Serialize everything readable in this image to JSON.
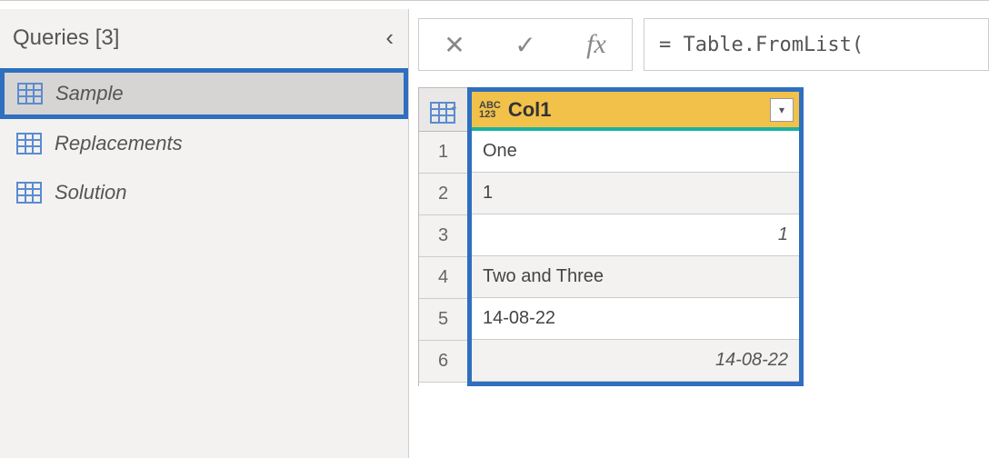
{
  "queries": {
    "header": "Queries [3]",
    "items": [
      {
        "name": "Sample",
        "selected": true
      },
      {
        "name": "Replacements",
        "selected": false
      },
      {
        "name": "Solution",
        "selected": false
      }
    ]
  },
  "formula_bar": {
    "expression": "= Table.FromList("
  },
  "table": {
    "column": {
      "type_hint_top": "ABC",
      "type_hint_bottom": "123",
      "name": "Col1"
    },
    "rows": [
      {
        "n": "1",
        "value": "One",
        "align": "left"
      },
      {
        "n": "2",
        "value": "1",
        "align": "left"
      },
      {
        "n": "3",
        "value": "1",
        "align": "right"
      },
      {
        "n": "4",
        "value": "Two and Three",
        "align": "left"
      },
      {
        "n": "5",
        "value": "14-08-22",
        "align": "left"
      },
      {
        "n": "6",
        "value": "14-08-22",
        "align": "right"
      }
    ]
  }
}
